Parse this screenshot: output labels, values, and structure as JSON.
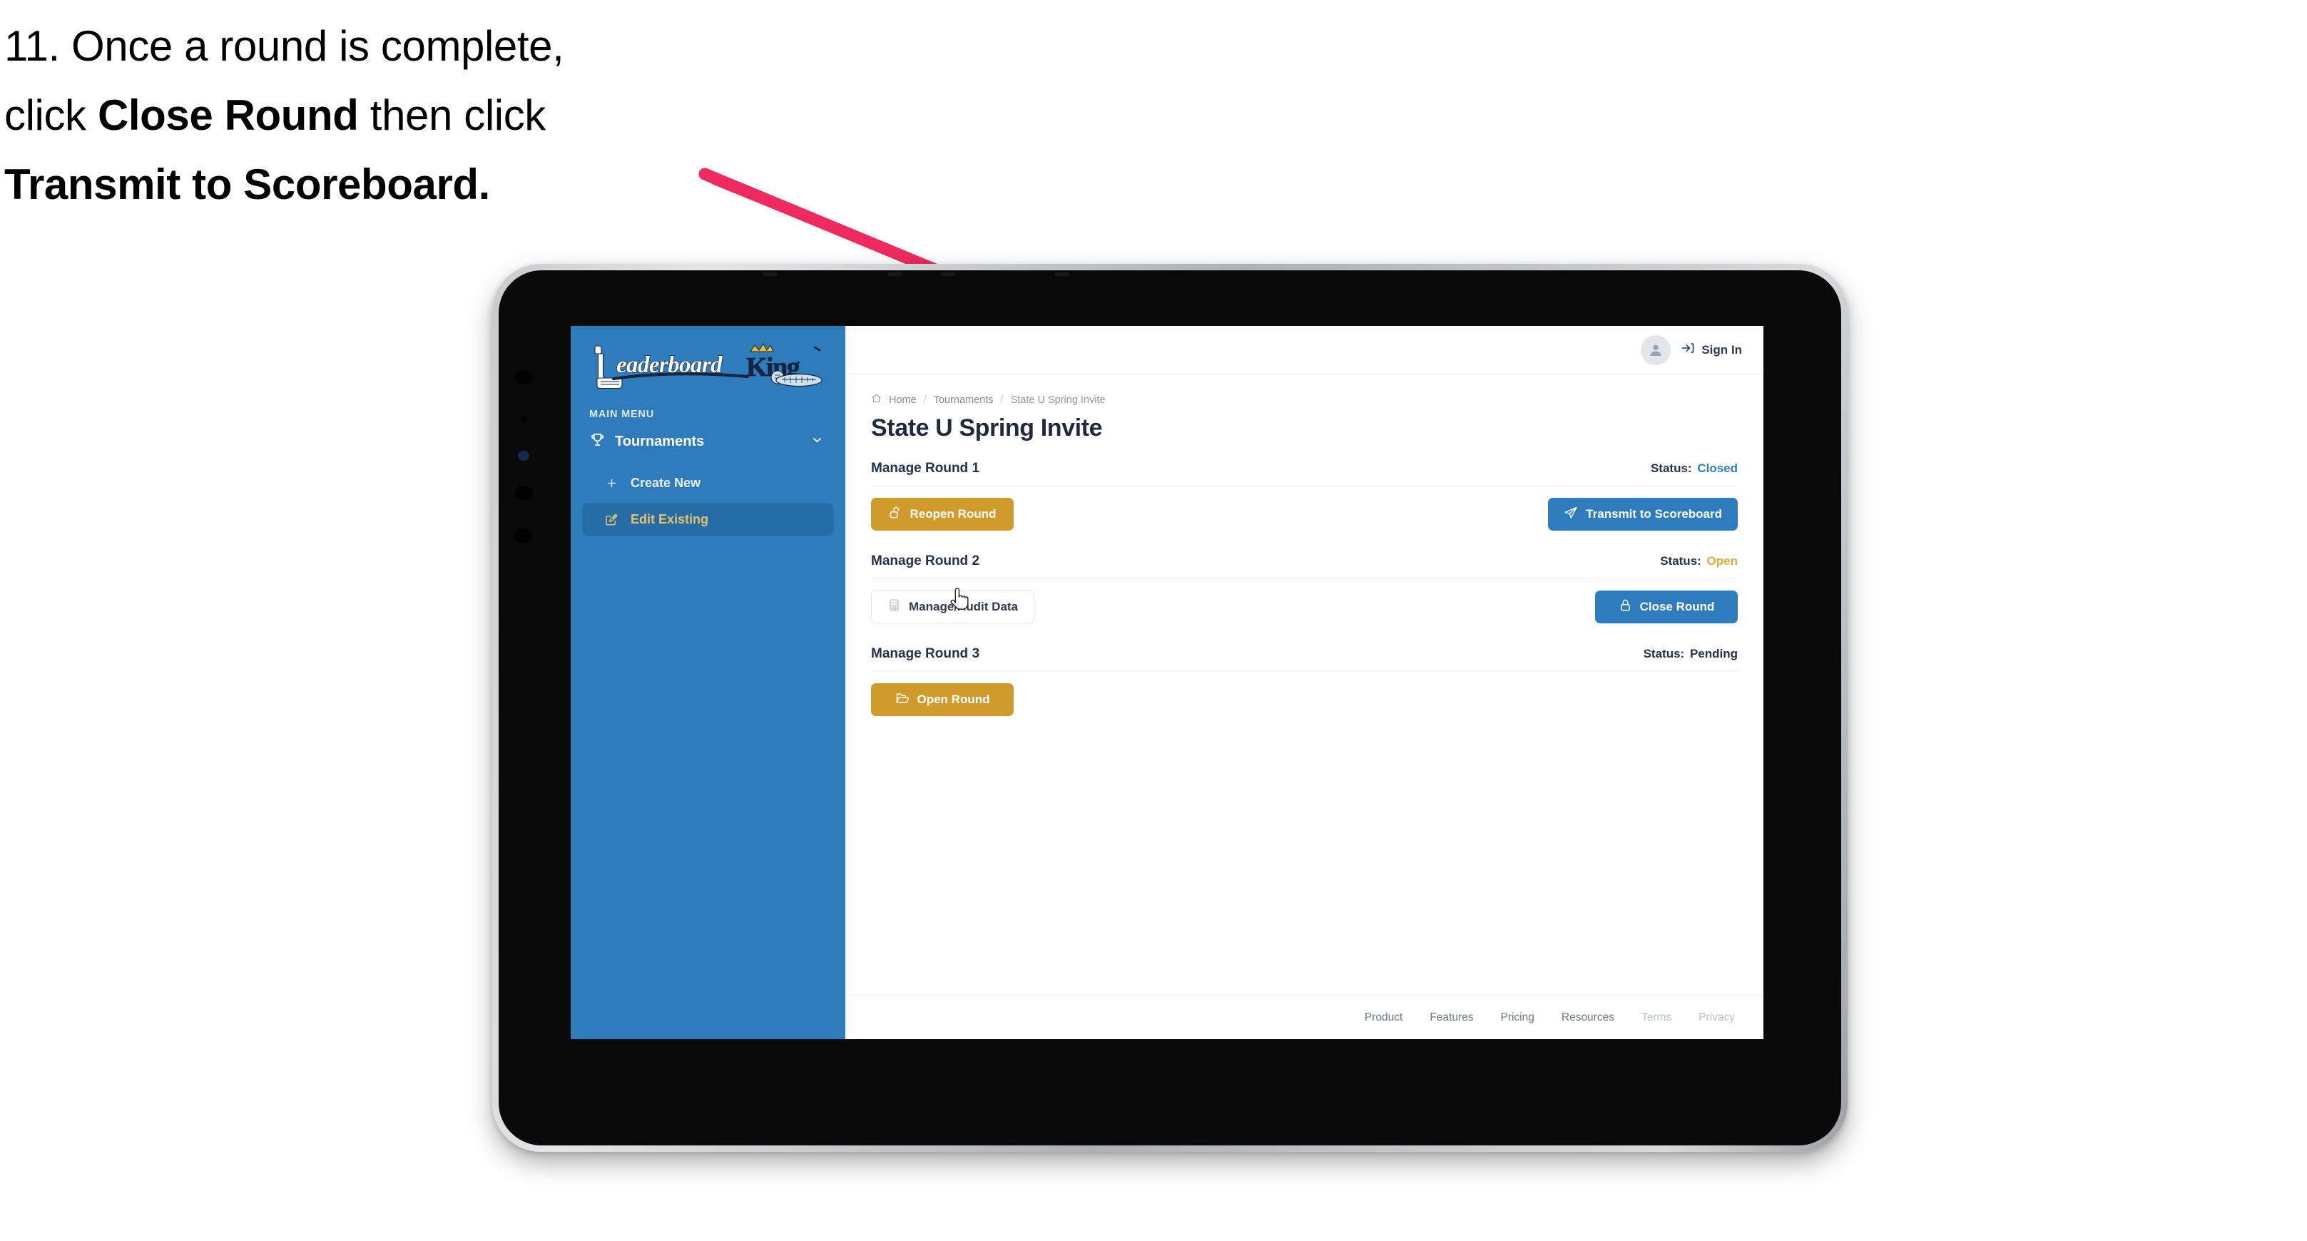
{
  "caption": {
    "line1_prefix": "11. Once a round is complete,",
    "line2_prefix": "click ",
    "line2_bold": "Close Round",
    "line2_suffix": " then click",
    "line3_bold": "Transmit to Scoreboard."
  },
  "colors": {
    "sidebar_blue": "#2e7cbc",
    "sidebar_active": "#266ca6",
    "accent_gold": "#cf9b2b",
    "accent_gold_text": "#e0a93c",
    "primary_blue": "#2e7cbc",
    "status_closed": "#2e7cbc",
    "status_open": "#e0a93c",
    "status_pending": "#24324a",
    "arrow_pink": "#ee2a5f",
    "text_dark": "#1f2a3c",
    "logo_navy": "#16263f",
    "crown_gold": "#e8b931"
  },
  "sidebar": {
    "logo": {
      "word_one": "Leaderboard",
      "word_two": "King",
      "icons": [
        "golf-putter-icon",
        "crown-icon",
        "golf-ball-icon"
      ]
    },
    "menu_label": "MAIN MENU",
    "items": [
      {
        "label": "Tournaments",
        "icon": "trophy-icon",
        "expand_icon": "chevron-down-icon",
        "active": false
      },
      {
        "label": "Create New",
        "icon": "plus-icon",
        "active": false
      },
      {
        "label": "Edit Existing",
        "icon": "edit-pencil-icon",
        "active": true
      }
    ]
  },
  "topbar": {
    "avatar_icon": "user-avatar-icon",
    "signin_icon": "login-arrow-icon",
    "signin_label": "Sign In"
  },
  "breadcrumb": {
    "home_icon": "home-icon",
    "items": [
      "Home",
      "Tournaments",
      "State U Spring Invite"
    ],
    "separator": "/"
  },
  "page_title": "State U Spring Invite",
  "rounds": [
    {
      "title": "Manage Round 1",
      "status_label": "Status:",
      "status_value": "Closed",
      "status_color": "#2e7cbc",
      "left_button": {
        "label": "Reopen Round",
        "icon": "unlock-icon",
        "style": "gold"
      },
      "right_button": {
        "label": "Transmit to Scoreboard",
        "icon": "send-paper-plane-icon",
        "style": "blue"
      }
    },
    {
      "title": "Manage Round 2",
      "status_label": "Status:",
      "status_value": "Open",
      "status_color": "#e0a93c",
      "left_button": {
        "label": "Manage/Audit Data",
        "icon": "table-grid-icon",
        "style": "ghost"
      },
      "right_button": {
        "label": "Close Round",
        "icon": "lock-icon",
        "style": "blue"
      }
    },
    {
      "title": "Manage Round 3",
      "status_label": "Status:",
      "status_value": "Pending",
      "status_color": "#24324a",
      "left_button": {
        "label": "Open Round",
        "icon": "open-folder-icon",
        "style": "gold"
      },
      "right_button": null
    }
  ],
  "footer": {
    "links": [
      {
        "label": "Product",
        "muted": false
      },
      {
        "label": "Features",
        "muted": false
      },
      {
        "label": "Pricing",
        "muted": false
      },
      {
        "label": "Resources",
        "muted": false
      },
      {
        "label": "Terms",
        "muted": true
      },
      {
        "label": "Privacy",
        "muted": true
      }
    ]
  },
  "annotation": {
    "arrow_icon": "pointer-arrow-annotation",
    "color": "#ee2a5f"
  },
  "cursor": {
    "icon": "pointing-hand-cursor"
  }
}
